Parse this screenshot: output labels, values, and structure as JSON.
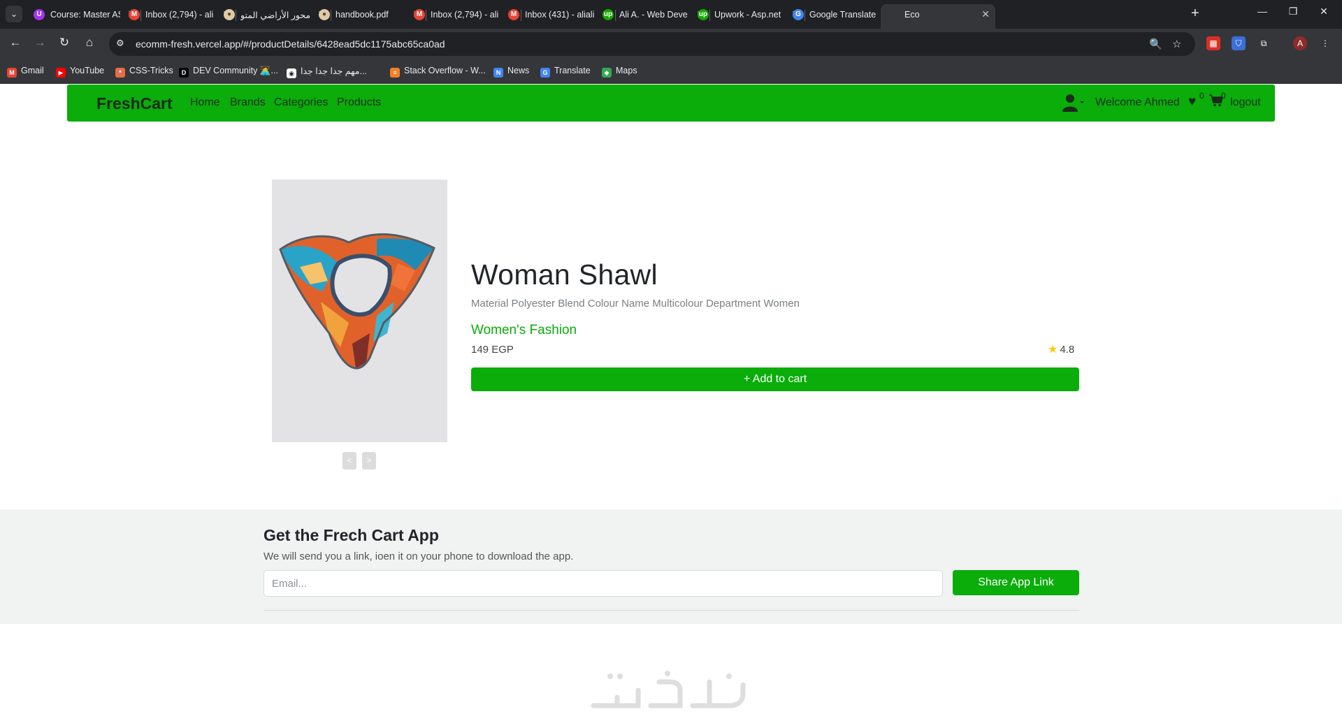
{
  "browser": {
    "tabs": [
      {
        "title": "Course: Master AS",
        "icon": "udemy-icon",
        "color": "#a435f0",
        "glyph": "U"
      },
      {
        "title": "Inbox (2,794) - ali",
        "icon": "gmail-icon",
        "color": "#ea4335",
        "glyph": "M"
      },
      {
        "title": "محور الأراضي المتو",
        "icon": "site-icon",
        "color": "#e0c9a6",
        "glyph": "●"
      },
      {
        "title": "handbook.pdf",
        "icon": "pdf-icon",
        "color": "#e0c9a6",
        "glyph": "●"
      },
      {
        "title": "Inbox (2,794) - ali",
        "icon": "gmail-icon",
        "color": "#ea4335",
        "glyph": "M"
      },
      {
        "title": "Inbox (431) - aliali",
        "icon": "gmail-icon",
        "color": "#ea4335",
        "glyph": "M"
      },
      {
        "title": "Ali A. - Web Deve",
        "icon": "upwork-icon",
        "color": "#14a800",
        "glyph": "up"
      },
      {
        "title": "Upwork - Asp.net",
        "icon": "upwork-icon",
        "color": "#14a800",
        "glyph": "up"
      },
      {
        "title": "Google Translate",
        "icon": "translate-icon",
        "color": "#4285f4",
        "glyph": "G"
      },
      {
        "title": "Eco",
        "icon": "blank-icon",
        "color": "#35363a",
        "glyph": ""
      }
    ],
    "url": "ecomm-fresh.vercel.app/#/productDetails/6428ead5dc1175abc65ca0ad",
    "profile_initial": "A",
    "bookmarks": [
      {
        "label": "Gmail",
        "color": "#ea4335",
        "glyph": "M"
      },
      {
        "label": "YouTube",
        "color": "#ff0000",
        "glyph": "▶"
      },
      {
        "label": "CSS-Tricks",
        "color": "#e36d49",
        "glyph": "*"
      },
      {
        "label": "DEV Community 👩‍💻...",
        "color": "#000000",
        "glyph": "D"
      },
      {
        "label": "مهم جدا جدا جدا...",
        "color": "#ffffff",
        "glyph": "◉"
      },
      {
        "label": "Stack Overflow - W...",
        "color": "#f48024",
        "glyph": "≡"
      },
      {
        "label": "News",
        "color": "#4285f4",
        "glyph": "N"
      },
      {
        "label": "Translate",
        "color": "#4285f4",
        "glyph": "G"
      },
      {
        "label": "Maps",
        "color": "#34a853",
        "glyph": "◆"
      }
    ]
  },
  "navbar": {
    "brand": "FreshCart",
    "links": [
      "Home",
      "Brands",
      "Categories",
      "Products"
    ],
    "welcome": "Welcome Ahmed",
    "wishlist_count": "0",
    "cart_count": "0",
    "logout": "logout"
  },
  "product": {
    "title": "Woman Shawl",
    "description": "Material Polyester Blend Colour Name Multicolour Department Women",
    "category": "Women's Fashion",
    "price": "149 EGP",
    "rating": "4.8",
    "add_to_cart": "+ Add to cart",
    "slider_prev": "<",
    "slider_next": ">"
  },
  "app_promo": {
    "title": "Get the Frech Cart App",
    "subtitle": "We will send you a link, ioen it on your phone to download the app.",
    "email_placeholder": "Email...",
    "share_button": "Share App Link"
  },
  "colors": {
    "brand_green": "#0aad0a",
    "star": "#ffc908",
    "band_bg": "#f0f3f2"
  }
}
